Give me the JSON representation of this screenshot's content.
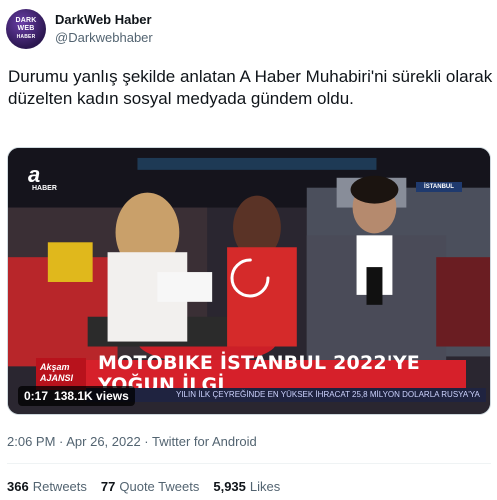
{
  "author": {
    "display_name": "DarkWeb Haber",
    "handle": "@Darkwebhaber",
    "avatar_text_line1": "DARK WEB",
    "avatar_text_line2": "HABER"
  },
  "tweet": {
    "text": "Durumu yanlış şekilde anlatan A Haber Muhabiri'ni sürekli olarak düzelten kadın sosyal medyada gündem oldu."
  },
  "media": {
    "time": "0:17",
    "views": "138.1K views",
    "channel_logo": "a",
    "channel_sub": "HABER",
    "banner_brand": "Akşam AJANSI",
    "banner_text": "MOTOBIKE İSTANBUL 2022'YE YOĞUN İLGİ",
    "crawl_text": "YILIN İLK ÇEYREĞİNDE EN YÜKSEK İHRACAT 25,8 MİLYON DOLARLA RUSYA'YA",
    "sign_text": "İSTANBUL"
  },
  "meta": {
    "timestamp": "2:06 PM · Apr 26, 2022 · Twitter for Android"
  },
  "stats": {
    "retweets_count": "366",
    "retweets_label": "Retweets",
    "quotes_count": "77",
    "quotes_label": "Quote Tweets",
    "likes_count": "5,935",
    "likes_label": "Likes"
  },
  "colors": {
    "ticker_red": "#d6202a",
    "secondary_text": "#536471",
    "primary_text": "#0f1419"
  }
}
